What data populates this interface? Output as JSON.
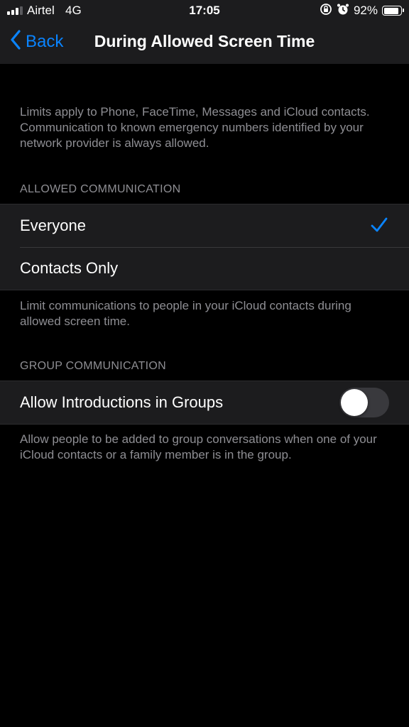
{
  "status_bar": {
    "carrier": "Airtel",
    "network": "4G",
    "time": "17:05",
    "battery_percent": "92%",
    "battery_level": 0.92,
    "signal_bars_active": 3,
    "icons": [
      "signal-icon",
      "orientation-lock-icon",
      "alarm-icon",
      "battery-icon"
    ]
  },
  "nav": {
    "back_label": "Back",
    "title": "During Allowed Screen Time"
  },
  "intro_text": "Limits apply to Phone, FaceTime, Messages and iCloud contacts. Communication to known emergency numbers identified by your network provider is always allowed.",
  "allowed_communication": {
    "header": "ALLOWED COMMUNICATION",
    "options": [
      {
        "label": "Everyone",
        "selected": true
      },
      {
        "label": "Contacts Only",
        "selected": false
      }
    ],
    "footer": "Limit communications to people in your iCloud contacts during allowed screen time."
  },
  "group_communication": {
    "header": "GROUP COMMUNICATION",
    "toggle_label": "Allow Introductions in Groups",
    "toggle_on": false,
    "footer": "Allow people to be added to group conversations when one of your iCloud contacts or a family member is in the group."
  },
  "colors": {
    "accent": "#0a84ff",
    "background": "#000000",
    "cell_background": "#1c1c1e",
    "secondary_text": "#8e8e93"
  }
}
